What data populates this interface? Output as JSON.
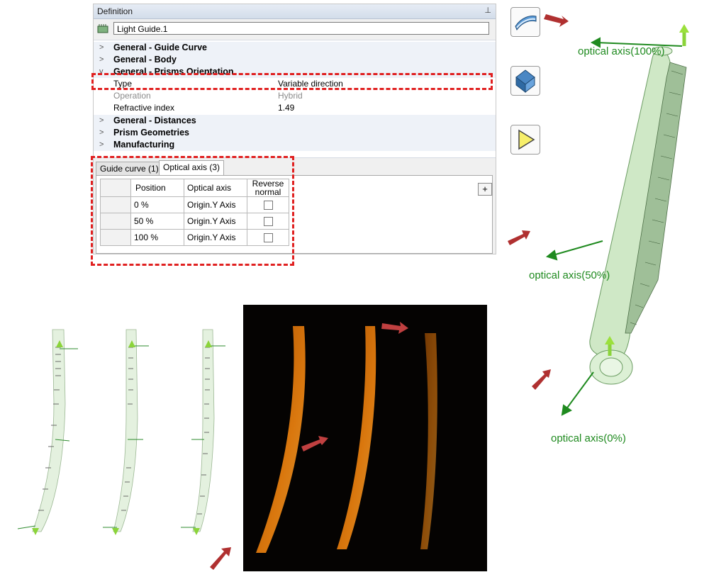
{
  "panel": {
    "title": "Definition",
    "pin_glyph": "⊥",
    "name_value": "Light Guide.1",
    "groups": [
      {
        "label": "General - Guide Curve",
        "expanded": false
      },
      {
        "label": "General - Body",
        "expanded": false
      },
      {
        "label": "General - Prisms Orientation",
        "expanded": true
      },
      {
        "label": "General - Distances",
        "expanded": false
      },
      {
        "label": "Prism Geometries",
        "expanded": false
      },
      {
        "label": "Manufacturing",
        "expanded": false
      }
    ],
    "properties": [
      {
        "label": "Type",
        "value": "Variable direction"
      },
      {
        "label": "Operation",
        "value": "Hybrid"
      },
      {
        "label": "Refractive index",
        "value": "1.49"
      }
    ]
  },
  "tabs": [
    {
      "label": "Guide curve (1)"
    },
    {
      "label": "Optical axis (3)"
    }
  ],
  "axis_table": {
    "headers": [
      "Position",
      "Optical axis",
      "Reverse normal"
    ],
    "rows": [
      {
        "position": "0 %",
        "axis": "Origin.Y Axis"
      },
      {
        "position": "50 %",
        "axis": "Origin.Y Axis"
      },
      {
        "position": "100 %",
        "axis": "Origin.Y Axis"
      }
    ],
    "add_label": "+"
  },
  "viewer": {
    "label_100": "optical axis(100%)",
    "label_50": "optical axis(50%)",
    "label_0": "optical axis(0%)"
  },
  "icons": [
    "light-guide-icon",
    "prism-icon",
    "play-icon"
  ],
  "colors": {
    "highlight": "#e02020",
    "axis": "#1f8a1f",
    "arrow": "#b03030",
    "guide": "#cfe8c6",
    "glow": "#ff8c10"
  }
}
